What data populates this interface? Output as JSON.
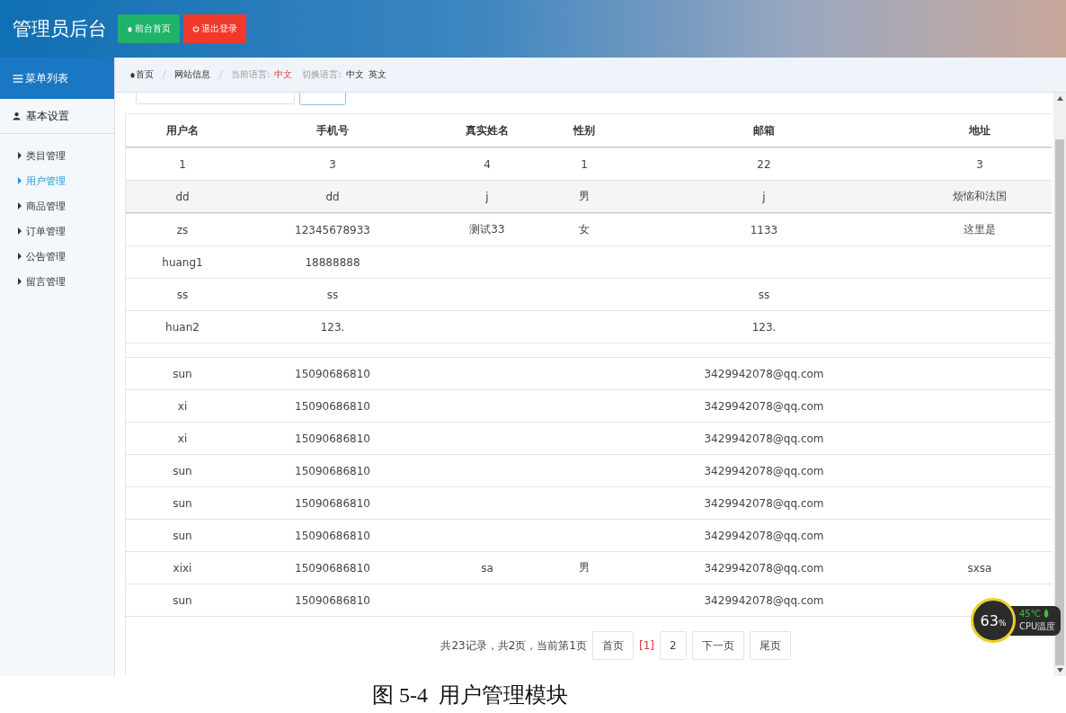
{
  "header": {
    "title": "管理员后台",
    "buttons": [
      {
        "label": "前台首页",
        "kind": "home"
      },
      {
        "label": "退出登录",
        "kind": "logout"
      }
    ]
  },
  "sidebar": {
    "title": "菜单列表",
    "section": "基本设置",
    "items": [
      {
        "label": "类目管理",
        "selected": false
      },
      {
        "label": "用户管理",
        "selected": true
      },
      {
        "label": "商品管理",
        "selected": false
      },
      {
        "label": "订单管理",
        "selected": false
      },
      {
        "label": "公告管理",
        "selected": false
      },
      {
        "label": "留言管理",
        "selected": false
      }
    ]
  },
  "breadcrumb": {
    "home": "首页",
    "page": "网站信息",
    "lang_label": "当前语言:",
    "lang_value": "中文",
    "switch_label": "切换语言:",
    "switch_options": [
      "中文",
      "英文"
    ]
  },
  "table": {
    "columns": [
      "用户名",
      "手机号",
      "真实姓名",
      "性别",
      "邮箱",
      "地址"
    ],
    "rows": [
      {
        "kind": "data",
        "highlighted": false,
        "cells": [
          "1",
          "3",
          "4",
          "1",
          "22",
          "3"
        ]
      },
      {
        "kind": "data",
        "highlighted": true,
        "cells": [
          "dd",
          "dd",
          "j",
          "男",
          "j",
          "烦恼和法国"
        ]
      },
      {
        "kind": "data",
        "highlighted": false,
        "cells": [
          "zs",
          "12345678933",
          "测试33",
          "女",
          "1133",
          "这里是"
        ]
      },
      {
        "kind": "data",
        "highlighted": false,
        "cells": [
          "huang1",
          "18888888",
          null,
          null,
          null,
          null
        ]
      },
      {
        "kind": "data",
        "highlighted": false,
        "cells": [
          "ss",
          "ss",
          null,
          null,
          "ss",
          null
        ]
      },
      {
        "kind": "data",
        "highlighted": false,
        "cells": [
          "huan2",
          "123.",
          null,
          null,
          "123.",
          null
        ]
      },
      {
        "kind": "blank",
        "cells": []
      },
      {
        "kind": "data",
        "highlighted": false,
        "cells": [
          "sun",
          "15090686810",
          null,
          null,
          "3429942078@qq.com",
          null
        ]
      },
      {
        "kind": "data",
        "highlighted": false,
        "cells": [
          "xi",
          "15090686810",
          null,
          null,
          "3429942078@qq.com",
          null
        ]
      },
      {
        "kind": "data",
        "highlighted": false,
        "cells": [
          "xi",
          "15090686810",
          null,
          null,
          "3429942078@qq.com",
          null
        ]
      },
      {
        "kind": "data",
        "highlighted": false,
        "cells": [
          "sun",
          "15090686810",
          null,
          null,
          "3429942078@qq.com",
          null
        ]
      },
      {
        "kind": "data",
        "highlighted": false,
        "cells": [
          "sun",
          "15090686810",
          null,
          null,
          "3429942078@qq.com",
          null
        ]
      },
      {
        "kind": "data",
        "highlighted": false,
        "cells": [
          "sun",
          "15090686810",
          null,
          null,
          "3429942078@qq.com",
          null
        ]
      },
      {
        "kind": "data",
        "highlighted": false,
        "cells": [
          "xixi",
          "15090686810",
          "sa",
          "男",
          "3429942078@qq.com",
          "sxsa"
        ]
      },
      {
        "kind": "data",
        "highlighted": false,
        "cells": [
          "sun",
          "15090686810",
          null,
          null,
          "3429942078@qq.com",
          null
        ]
      }
    ]
  },
  "pagination": {
    "summary": "共23记录，共2页，当前第1页",
    "first": "首页",
    "pages": [
      {
        "label": "[1]",
        "selected": true
      },
      {
        "label": "2",
        "selected": false
      }
    ],
    "next": "下一页",
    "last": "尾页"
  },
  "cpu_widget": {
    "usage": "63",
    "unit": "%",
    "temperature": "45℃",
    "label": "CPU温度"
  },
  "caption": "图 5-4  用户管理模块"
}
